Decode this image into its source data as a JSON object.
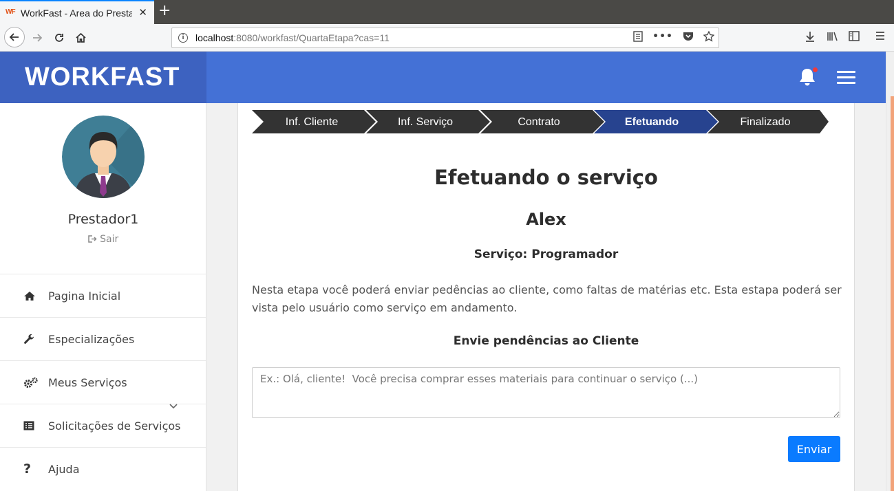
{
  "browser": {
    "tab_title": "WorkFast - Area do Prestador",
    "favicon_text": "WF",
    "tab_close": "✕",
    "new_tab": "+",
    "url_host": "localhost",
    "url_rest": ":8080/workfast/QuartaEtapa?cas=11"
  },
  "header": {
    "brand": "WORKFAST",
    "accent_color": "#4471d6",
    "brand_color": "#3d62c0"
  },
  "sidebar": {
    "username": "Prestador1",
    "logout_label": "Sair",
    "items": [
      {
        "label": "Pagina Inicial",
        "icon": "home-icon"
      },
      {
        "label": "Especializações",
        "icon": "wrench-icon"
      },
      {
        "label": "Meus Serviços",
        "icon": "gears-icon"
      },
      {
        "label": "Solicitações de Serviços",
        "icon": "list-icon"
      },
      {
        "label": "Ajuda",
        "icon": "question-icon"
      }
    ]
  },
  "steps": [
    {
      "label": "Inf. Cliente",
      "active": false
    },
    {
      "label": "Inf. Serviço",
      "active": false
    },
    {
      "label": "Contrato",
      "active": false
    },
    {
      "label": "Efetuando",
      "active": true
    },
    {
      "label": "Finalizado",
      "active": false
    }
  ],
  "main": {
    "title": "Efetuando o serviço",
    "client_name": "Alex",
    "service_line": "Serviço: Programador",
    "description": "Nesta etapa você poderá enviar pedências ao cliente, como faltas de matérias etc. Esta estapa poderá ser vista pelo usuário como serviço em andamento.",
    "pending_title": "Envie pendências ao Cliente",
    "pending_placeholder": "Ex.: Olá, cliente!  Você precisa comprar esses materiais para continuar o serviço (...)",
    "pending_value": "",
    "send_label": "Enviar"
  }
}
